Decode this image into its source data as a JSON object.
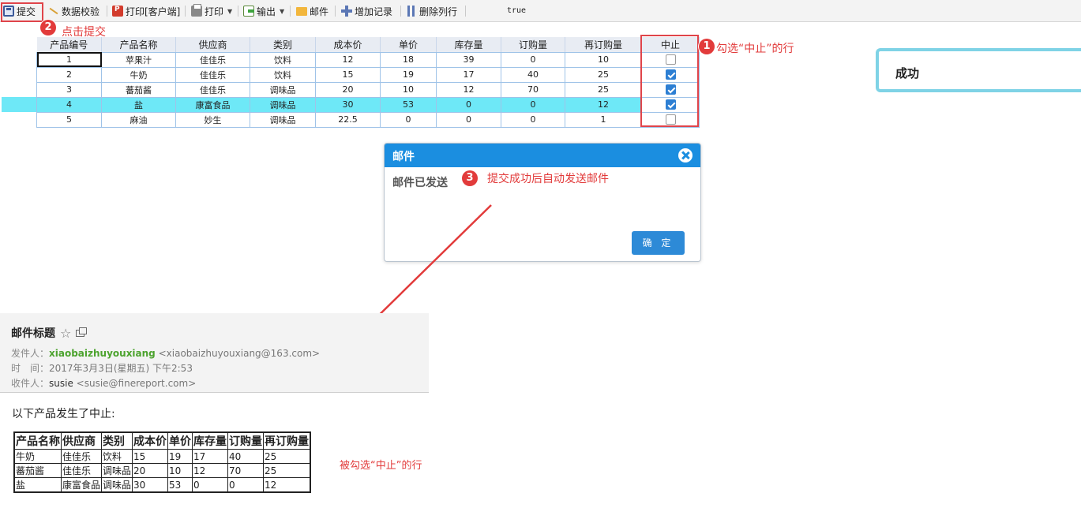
{
  "toolbar": {
    "items": [
      {
        "label": "提交",
        "icon": "save-icon"
      },
      {
        "label": "数据校验",
        "icon": "check-icon"
      },
      {
        "label": "打印[客户端]",
        "icon": "pdf-icon"
      },
      {
        "label": "打印",
        "icon": "printer-icon",
        "dropdown": true
      },
      {
        "label": "输出",
        "icon": "export-icon",
        "dropdown": true
      },
      {
        "label": "邮件",
        "icon": "mail-icon"
      },
      {
        "label": "增加记录",
        "icon": "add-row-icon"
      },
      {
        "label": "删除列行",
        "icon": "delete-row-icon"
      }
    ],
    "status_text": "true"
  },
  "annotations": {
    "step1": {
      "num": "1",
      "text": "勾选“中止”的行"
    },
    "step2": {
      "num": "2",
      "text": "点击提交"
    },
    "step3": {
      "num": "3",
      "text": "提交成功后自动发送邮件"
    },
    "checked_rows_note": "被勾选“中止”的行",
    "accent_color": "#e23b3b"
  },
  "grid": {
    "headers": [
      "产品编号",
      "产品名称",
      "供应商",
      "类别",
      "成本价",
      "单价",
      "库存量",
      "订购量",
      "再订购量",
      "中止"
    ],
    "rows": [
      {
        "id": "1",
        "name": "苹果汁",
        "supplier": "佳佳乐",
        "category": "饮料",
        "cost": "12",
        "price": "18",
        "stock": "39",
        "ordered": "0",
        "reorder": "10",
        "discontinued": false
      },
      {
        "id": "2",
        "name": "牛奶",
        "supplier": "佳佳乐",
        "category": "饮料",
        "cost": "15",
        "price": "19",
        "stock": "17",
        "ordered": "40",
        "reorder": "25",
        "discontinued": true
      },
      {
        "id": "3",
        "name": "蕃茄酱",
        "supplier": "佳佳乐",
        "category": "调味品",
        "cost": "20",
        "price": "10",
        "stock": "12",
        "ordered": "70",
        "reorder": "25",
        "discontinued": true
      },
      {
        "id": "4",
        "name": "盐",
        "supplier": "康富食品",
        "category": "调味品",
        "cost": "30",
        "price": "53",
        "stock": "0",
        "ordered": "0",
        "reorder": "12",
        "discontinued": true
      },
      {
        "id": "5",
        "name": "麻油",
        "supplier": "妙生",
        "category": "调味品",
        "cost": "22.5",
        "price": "0",
        "stock": "0",
        "ordered": "0",
        "reorder": "1",
        "discontinued": false
      }
    ],
    "highlight_row_color": "#6ee8f7"
  },
  "toast": {
    "text": "成功"
  },
  "dialog": {
    "title": "邮件",
    "message": "邮件已发送",
    "ok_label": "确 定",
    "header_color": "#1b8ee0"
  },
  "email": {
    "subject": "邮件标题",
    "from_label": "发件人：",
    "from_name": "xiaobaizhuyouxiang",
    "from_addr": "<xiaobaizhuyouxiang@163.com>",
    "time_label": "时　间：",
    "time_value": "2017年3月3日(星期五) 下午2:53",
    "to_label": "收件人：",
    "to_name": "susie",
    "to_addr": "<susie@finereport.com>",
    "intro": "以下产品发生了中止:",
    "table_headers": [
      "产品名称",
      "供应商",
      "类别",
      "成本价",
      "单价",
      "库存量",
      "订购量",
      "再订购量"
    ],
    "table_rows": [
      [
        "牛奶",
        "佳佳乐",
        "饮料",
        "15",
        "19",
        "17",
        "40",
        "25"
      ],
      [
        "蕃茄酱",
        "佳佳乐",
        "调味品",
        "20",
        "10",
        "12",
        "70",
        "25"
      ],
      [
        "盐",
        "康富食品",
        "调味品",
        "30",
        "53",
        "0",
        "0",
        "12"
      ]
    ]
  }
}
